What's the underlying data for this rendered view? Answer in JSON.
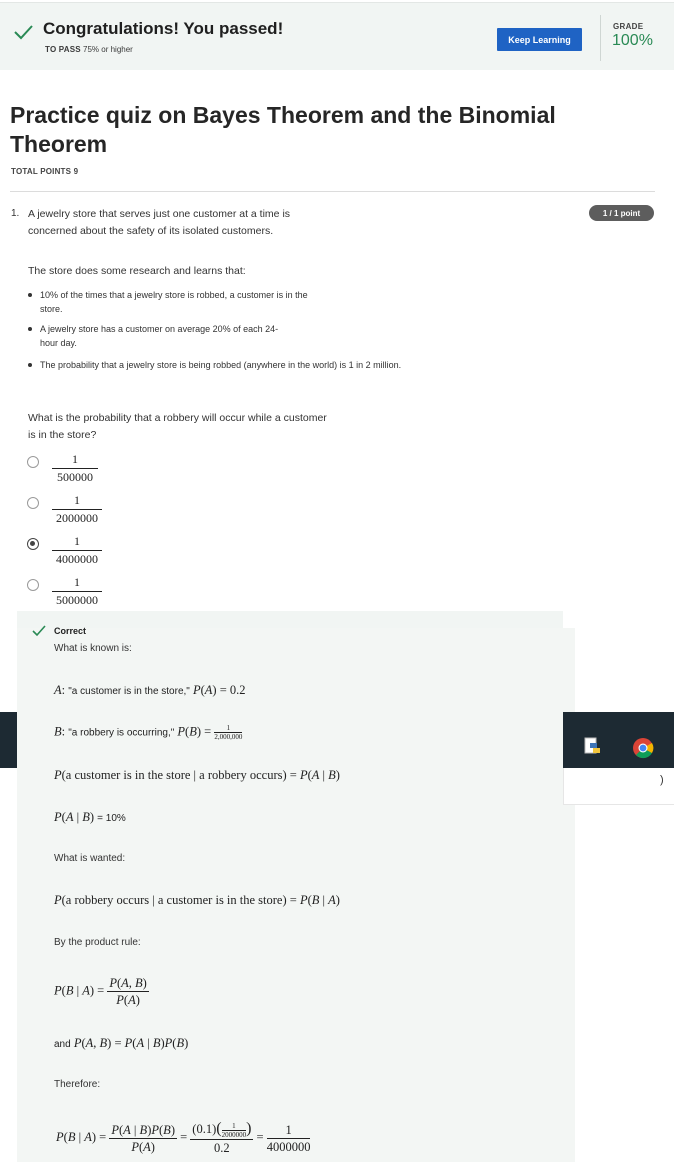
{
  "banner": {
    "title": "Congratulations! You passed!",
    "to_pass_label": "TO PASS",
    "to_pass_value": "75% or higher",
    "keep_learning": "Keep Learning",
    "grade_label": "GRADE",
    "grade_value": "100%",
    "accent_color": "#1f63c4",
    "grade_color": "#2a8a55"
  },
  "quiz": {
    "title": "Practice quiz on Bayes Theorem and the Binomial Theorem",
    "total_points": "TOTAL POINTS 9"
  },
  "question": {
    "number": "1.",
    "points_badge": "1 / 1 point",
    "intro": "A jewelry store that serves just one customer at a time is concerned about the safety of its isolated customers.",
    "research": "The store does some research and learns that:",
    "bullets": [
      "10% of the times that a jewelry store is robbed, a customer is in the store.",
      "A jewelry store has a customer on average 20% of each 24-hour day.",
      "The probability that a jewelry store is being robbed (anywhere in the world) is 1 in 2 million."
    ],
    "ask": "What is the probability that a robbery will occur while a customer is in the store?",
    "options": [
      {
        "num": "1",
        "den": "500000",
        "selected": false
      },
      {
        "num": "1",
        "den": "2000000",
        "selected": false
      },
      {
        "num": "1",
        "den": "4000000",
        "selected": true
      },
      {
        "num": "1",
        "den": "5000000",
        "selected": false
      }
    ]
  },
  "feedback": {
    "status": "Correct",
    "known": "What is known is:",
    "a_def_text": "\"a customer is in the store,\"",
    "b_def_text": "\"a robbery is occurring,\"",
    "wanted": "What is wanted:",
    "product_rule": "By the product rule:",
    "and_text": "and",
    "therefore": "Therefore:",
    "answer_num": "1",
    "answer_den": "4000000"
  },
  "taskbar": {
    "icons": [
      "python-icon",
      "chrome-icon"
    ]
  }
}
